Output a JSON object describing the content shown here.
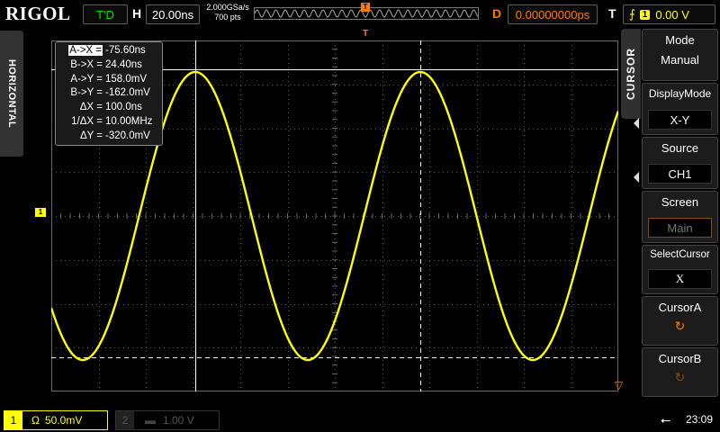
{
  "brand": "RIGOL",
  "status": {
    "run_state": "T'D",
    "horiz_label": "H",
    "timebase": "20.00ns",
    "sample_rate": "2.000GSa/s",
    "memory_depth": "700  pts",
    "delay_label": "D",
    "delay_value": "0.00000000ps",
    "trigger_label": "T",
    "trigger_channel": "1",
    "trigger_level": "0.00 V"
  },
  "side_label": "HORIZONTAL",
  "cursor_readout": [
    {
      "key": "A->X =",
      "value": "-75.60ns"
    },
    {
      "key": "B->X =",
      "value": "24.40ns"
    },
    {
      "key": "A->Y =",
      "value": "158.0mV"
    },
    {
      "key": "B->Y =",
      "value": "-162.0mV"
    },
    {
      "key": "ΔX =",
      "value": "100.0ns"
    },
    {
      "key": "1/ΔX =",
      "value": "10.00MHz"
    },
    {
      "key": "ΔY =",
      "value": "-320.0mV"
    }
  ],
  "menu": {
    "title": "CURSOR",
    "items": [
      {
        "label": "Mode",
        "value": "Manual"
      },
      {
        "label": "DisplayMode",
        "value": "X-Y"
      },
      {
        "label": "Source",
        "value": "CH1"
      },
      {
        "label": "Screen",
        "value": "Main"
      },
      {
        "label": "SelectCursor",
        "value": "X"
      },
      {
        "label": "CursorA",
        "value": "↻"
      },
      {
        "label": "CursorB",
        "value": "↻"
      }
    ]
  },
  "channels": [
    {
      "num": "1",
      "coupling": "Ω",
      "scale": "50.0mV"
    },
    {
      "num": "2",
      "coupling": "",
      "scale": "1.00 V"
    }
  ],
  "clock": "23:09",
  "colors": {
    "ch1": "#ffff00",
    "grid": "#555555",
    "accent": "#ff7a00"
  },
  "icons": {
    "usb": "usb-icon",
    "trigger_edge": "trigger-rising-edge-icon"
  }
}
